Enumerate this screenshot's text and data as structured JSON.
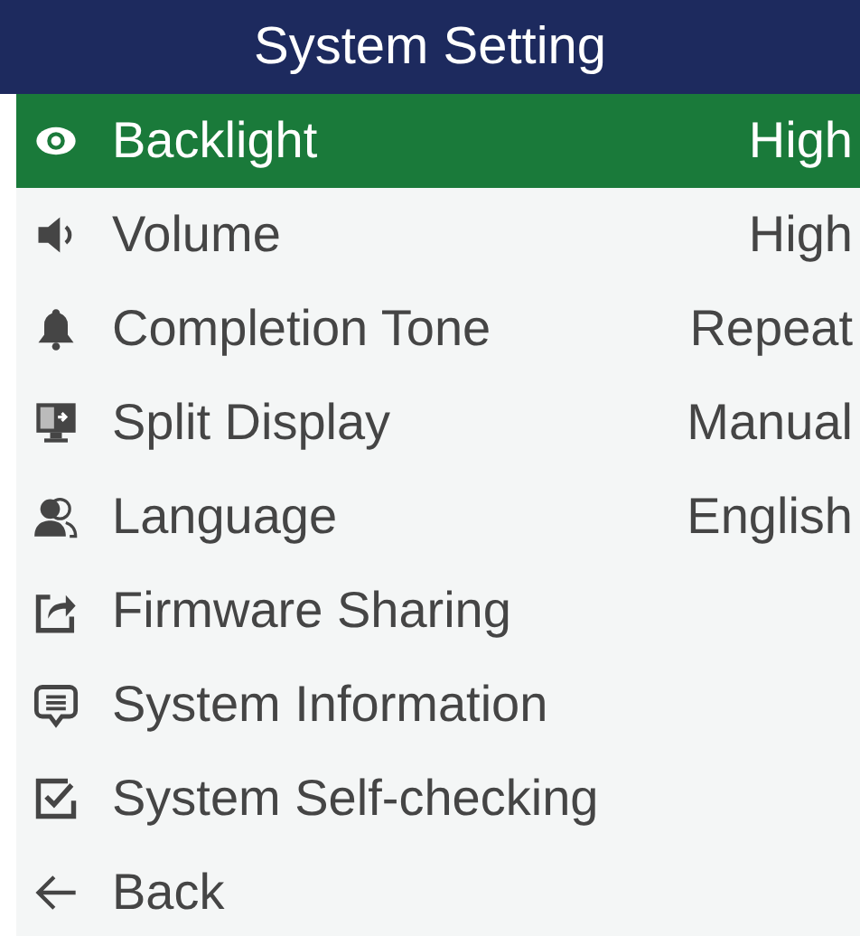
{
  "window": {
    "title": "System Setting"
  },
  "items": [
    {
      "kind": "eye",
      "label": "Backlight",
      "value": "High",
      "selected": true
    },
    {
      "kind": "speaker",
      "label": "Volume",
      "value": "High",
      "selected": false
    },
    {
      "kind": "bell",
      "label": "Completion Tone",
      "value": "Repeat",
      "selected": false
    },
    {
      "kind": "monitor",
      "label": "Split Display",
      "value": "Manual",
      "selected": false
    },
    {
      "kind": "people",
      "label": "Language",
      "value": "English",
      "selected": false
    },
    {
      "kind": "share",
      "label": "Firmware Sharing",
      "selected": false
    },
    {
      "kind": "message",
      "label": "System Information",
      "selected": false
    },
    {
      "kind": "checkbox",
      "label": "System Self-checking",
      "selected": false
    },
    {
      "kind": "back",
      "label": "Back",
      "selected": false
    }
  ]
}
